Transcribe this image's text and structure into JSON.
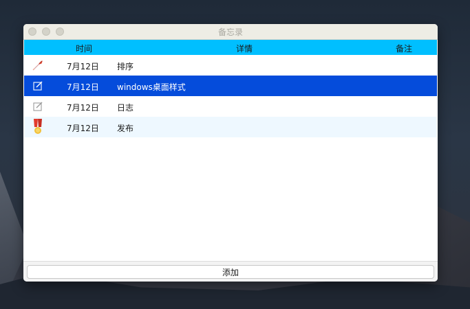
{
  "window": {
    "title": "备忘录"
  },
  "table": {
    "headers": {
      "time": "时间",
      "detail": "详情",
      "note": "备注"
    },
    "rows": [
      {
        "icon": "rocket-icon",
        "date": "7月12日",
        "detail": "排序",
        "note": ""
      },
      {
        "icon": "edit-icon",
        "date": "7月12日",
        "detail": "windows桌面样式",
        "note": "",
        "selected": true
      },
      {
        "icon": "edit-icon",
        "date": "7月12日",
        "detail": "日志",
        "note": ""
      },
      {
        "icon": "medal-icon",
        "date": "7月12日",
        "detail": "发布",
        "note": ""
      }
    ]
  },
  "footer": {
    "add_label": "添加"
  },
  "colors": {
    "header_bg": "#00bfff",
    "selected_bg": "#054cdb",
    "alt_row_bg": "#eef8ff"
  }
}
